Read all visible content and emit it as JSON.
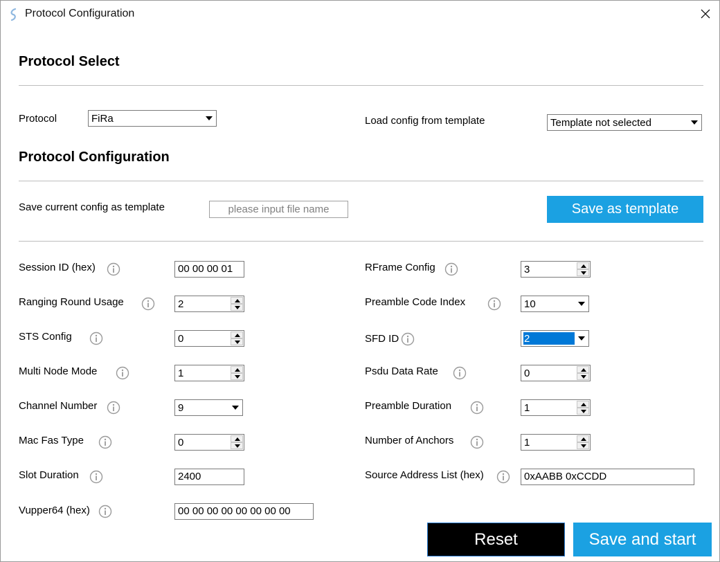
{
  "window": {
    "title": "Protocol Configuration"
  },
  "protocol_select": {
    "heading": "Protocol Select",
    "protocol_label": "Protocol",
    "protocol_value": "FiRa",
    "template_label": "Load config from template",
    "template_value": "Template not selected"
  },
  "protocol_config": {
    "heading": "Protocol Configuration",
    "save_template_label": "Save current config as template",
    "file_name_placeholder": "please input file name",
    "save_template_button": "Save as template"
  },
  "fields": {
    "session_id": {
      "label": "Session ID (hex)",
      "value": "00 00 00 01"
    },
    "ranging_round_usage": {
      "label": "Ranging Round Usage",
      "value": "2"
    },
    "sts_config": {
      "label": "STS Config",
      "value": "0"
    },
    "multi_node_mode": {
      "label": "Multi Node Mode",
      "value": "1"
    },
    "channel_number": {
      "label": "Channel Number",
      "value": "9"
    },
    "mac_fas_type": {
      "label": "Mac Fas Type",
      "value": "0"
    },
    "slot_duration": {
      "label": "Slot Duration",
      "value": "2400"
    },
    "vupper64": {
      "label": "Vupper64 (hex)",
      "value": "00 00 00 00 00 00 00 00"
    },
    "rframe_config": {
      "label": "RFrame Config",
      "value": "3"
    },
    "preamble_code_index": {
      "label": "Preamble Code Index",
      "value": "10"
    },
    "sfd_id": {
      "label": "SFD ID",
      "value": "2"
    },
    "psdu_data_rate": {
      "label": "Psdu Data Rate",
      "value": "0"
    },
    "preamble_duration": {
      "label": "Preamble Duration",
      "value": "1"
    },
    "number_of_anchors": {
      "label": "Number of Anchors",
      "value": "1"
    },
    "source_address_list": {
      "label": "Source Address List (hex)",
      "value": "0xAABB 0xCCDD"
    }
  },
  "actions": {
    "reset_label": "Reset",
    "save_start_label": "Save and start"
  },
  "colors": {
    "accent": "#1ba1e2",
    "selection": "#0078d7",
    "reset_bg": "#000000"
  },
  "icons": {
    "app": "app-logo-icon",
    "close": "close-icon",
    "info": "info-icon",
    "dropdown": "dropdown-arrow-icon",
    "spin_up": "spin-up-icon",
    "spin_down": "spin-down-icon"
  }
}
